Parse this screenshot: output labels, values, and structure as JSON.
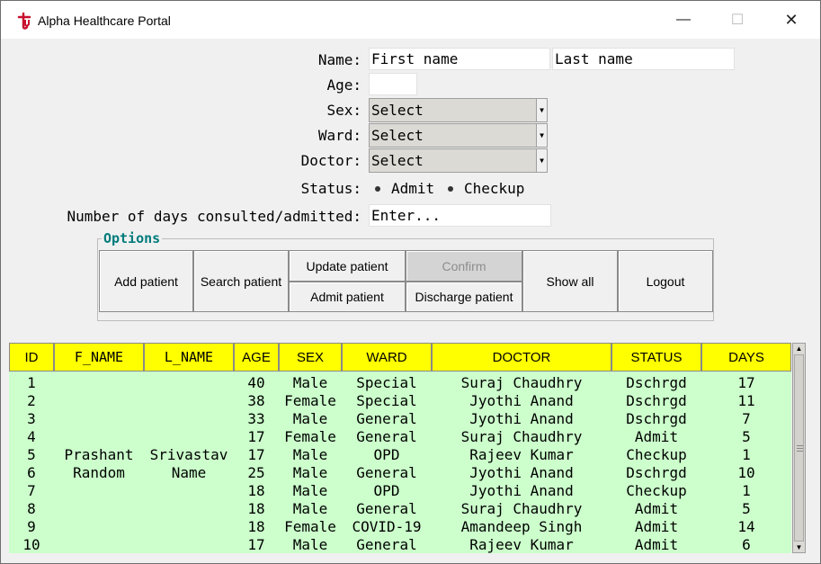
{
  "window": {
    "title": "Alpha Healthcare Portal",
    "minimize_icon": "minimize-icon",
    "maximize_icon": "maximize-icon",
    "close_icon": "close-icon"
  },
  "form": {
    "name_label": "Name:",
    "first_name_placeholder": "First name",
    "last_name_placeholder": "Last name",
    "age_label": "Age:",
    "age_value": "",
    "sex_label": "Sex:",
    "sex_value": "Select",
    "ward_label": "Ward:",
    "ward_value": "Select",
    "doctor_label": "Doctor:",
    "doctor_value": "Select",
    "status_label": "Status:",
    "status_options": [
      "Admit",
      "Checkup"
    ],
    "days_label": "Number of days consulted/admitted:",
    "days_placeholder": "Enter..."
  },
  "options": {
    "title": "Options",
    "add_patient": "Add patient",
    "search_patient": "Search patient",
    "update_patient": "Update patient",
    "confirm": "Confirm",
    "admit_patient": "Admit patient",
    "discharge_patient": "Discharge patient",
    "show_all": "Show all",
    "logout": "Logout"
  },
  "table": {
    "columns": [
      "ID",
      "F_NAME",
      "L_NAME",
      "AGE",
      "SEX",
      "WARD",
      "DOCTOR",
      "STATUS",
      "DAYS"
    ],
    "rows": [
      [
        "1",
        "",
        "",
        "40",
        "Male",
        "Special",
        "Suraj Chaudhry",
        "Dschrgd",
        "17"
      ],
      [
        "2",
        "",
        "",
        "38",
        "Female",
        "Special",
        "Jyothi Anand",
        "Dschrgd",
        "11"
      ],
      [
        "3",
        "",
        "",
        "33",
        "Male",
        "General",
        "Jyothi Anand",
        "Dschrgd",
        "7"
      ],
      [
        "4",
        "",
        "",
        "17",
        "Female",
        "General",
        "Suraj Chaudhry",
        "Admit",
        "5"
      ],
      [
        "5",
        "Prashant",
        "Srivastav",
        "17",
        "Male",
        "OPD",
        "Rajeev Kumar",
        "Checkup",
        "1"
      ],
      [
        "6",
        "Random",
        "Name",
        "25",
        "Male",
        "General",
        "Jyothi Anand",
        "Dschrgd",
        "10"
      ],
      [
        "7",
        "",
        "",
        "18",
        "Male",
        "OPD",
        "Jyothi Anand",
        "Checkup",
        "1"
      ],
      [
        "8",
        "",
        "",
        "18",
        "Male",
        "General",
        "Suraj Chaudhry",
        "Admit",
        "5"
      ],
      [
        "9",
        "",
        "",
        "18",
        "Female",
        "COVID-19",
        "Amandeep Singh",
        "Admit",
        "14"
      ],
      [
        "10",
        "",
        "",
        "17",
        "Male",
        "General",
        "Rajeev Kumar",
        "Admit",
        "6"
      ]
    ]
  },
  "colors": {
    "header_bg": "#ffff00",
    "table_bg": "#ccffcc",
    "options_title": "#007b7b"
  }
}
